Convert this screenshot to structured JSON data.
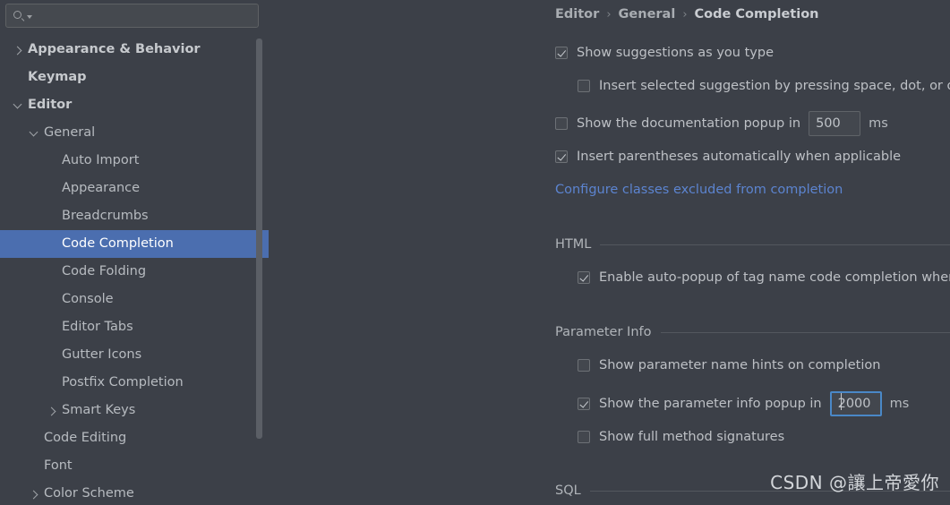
{
  "search": {
    "placeholder": "",
    "value": "",
    "icon": "search-icon",
    "dropdown_icon": "chevron-down-icon"
  },
  "sidebar": {
    "items": [
      {
        "label": "Appearance & Behavior",
        "indent": 0,
        "arrow": "right",
        "bold": true,
        "selected": false
      },
      {
        "label": "Keymap",
        "indent": 0,
        "arrow": "none",
        "bold": true,
        "selected": false
      },
      {
        "label": "Editor",
        "indent": 0,
        "arrow": "down",
        "bold": true,
        "selected": false
      },
      {
        "label": "General",
        "indent": 1,
        "arrow": "down",
        "bold": false,
        "selected": false
      },
      {
        "label": "Auto Import",
        "indent": 2,
        "arrow": "none",
        "bold": false,
        "selected": false
      },
      {
        "label": "Appearance",
        "indent": 2,
        "arrow": "none",
        "bold": false,
        "selected": false
      },
      {
        "label": "Breadcrumbs",
        "indent": 2,
        "arrow": "none",
        "bold": false,
        "selected": false
      },
      {
        "label": "Code Completion",
        "indent": 2,
        "arrow": "none",
        "bold": false,
        "selected": true
      },
      {
        "label": "Code Folding",
        "indent": 2,
        "arrow": "none",
        "bold": false,
        "selected": false
      },
      {
        "label": "Console",
        "indent": 2,
        "arrow": "none",
        "bold": false,
        "selected": false
      },
      {
        "label": "Editor Tabs",
        "indent": 2,
        "arrow": "none",
        "bold": false,
        "selected": false
      },
      {
        "label": "Gutter Icons",
        "indent": 2,
        "arrow": "none",
        "bold": false,
        "selected": false
      },
      {
        "label": "Postfix Completion",
        "indent": 2,
        "arrow": "none",
        "bold": false,
        "selected": false
      },
      {
        "label": "Smart Keys",
        "indent": 2,
        "arrow": "right",
        "bold": false,
        "selected": false
      },
      {
        "label": "Code Editing",
        "indent": 1,
        "arrow": "none",
        "bold": false,
        "selected": false
      },
      {
        "label": "Font",
        "indent": 1,
        "arrow": "none",
        "bold": false,
        "selected": false
      },
      {
        "label": "Color Scheme",
        "indent": 1,
        "arrow": "right",
        "bold": false,
        "selected": false
      }
    ]
  },
  "breadcrumb": {
    "crumbs": [
      "Editor",
      "General",
      "Code Completion"
    ],
    "separator": "›"
  },
  "main": {
    "options": [
      {
        "label": "Show suggestions as you type",
        "checked": true
      },
      {
        "label": "Insert selected suggestion by pressing space, dot, or other context-dependent keys",
        "checked": false
      },
      {
        "label": "Show the documentation popup in",
        "checked": false
      },
      {
        "label": "Insert parentheses automatically when applicable",
        "checked": true
      }
    ],
    "doc_popup_delay": "500",
    "doc_popup_unit": "ms",
    "excluded_link": "Configure classes excluded from completion",
    "sections": {
      "html": {
        "title": "HTML",
        "option": {
          "label": "Enable auto-popup of tag name code completion when typing in HTML text",
          "checked": true
        }
      },
      "parameter_info": {
        "title": "Parameter Info",
        "options": [
          {
            "label": "Show parameter name hints on completion",
            "checked": false
          },
          {
            "label": "Show the parameter info popup in",
            "checked": true
          },
          {
            "label": "Show full method signatures",
            "checked": false
          }
        ],
        "popup_delay": "2000",
        "popup_unit": "ms"
      },
      "sql": {
        "title": "SQL"
      }
    }
  },
  "watermark": "CSDN @讓上帝愛你",
  "colors": {
    "background": "#3c4048",
    "selection": "#4b6eaf",
    "link": "#5c84d0",
    "focus_border": "#4a88c7",
    "text": "#bdc0c5",
    "separator": "#53575e"
  }
}
